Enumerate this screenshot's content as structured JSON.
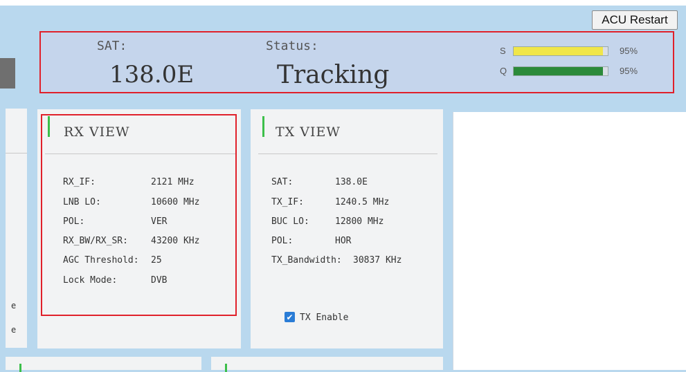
{
  "acu_restart_label": "ACU Restart",
  "header": {
    "sat_label": "SAT:",
    "sat_value": "138.0E",
    "status_label": "Status:",
    "status_value": "Tracking",
    "meters": [
      {
        "label": "S",
        "percent_text": "95%",
        "level": 0.95,
        "color": "#f0e64a"
      },
      {
        "label": "Q",
        "percent_text": "95%",
        "level": 0.95,
        "color": "#2b8a3a"
      }
    ]
  },
  "left_stub": {
    "items": [
      "e",
      "e"
    ]
  },
  "rx_view": {
    "title": "RX VIEW",
    "rows": [
      {
        "label": "RX_IF:",
        "value": "2121 MHz"
      },
      {
        "label": "LNB LO:",
        "value": "10600 MHz"
      },
      {
        "label": "POL:",
        "value": "VER"
      },
      {
        "label": "RX_BW/RX_SR:",
        "value": "43200 KHz"
      },
      {
        "label": "AGC Threshold:",
        "value": "25"
      },
      {
        "label": "Lock Mode:",
        "value": "DVB"
      }
    ]
  },
  "tx_view": {
    "title": "TX VIEW",
    "rows": [
      {
        "label": "SAT:",
        "value": "138.0E"
      },
      {
        "label": "TX_IF:",
        "value": "1240.5 MHz"
      },
      {
        "label": "BUC LO:",
        "value": "12800 MHz"
      },
      {
        "label": "POL:",
        "value": "HOR"
      },
      {
        "label": "TX_Bandwidth:",
        "value": "30837 KHz"
      }
    ],
    "tx_enable_label": "TX Enable",
    "tx_enable_checked": true
  },
  "colors": {
    "accent_green": "#3cbf4a",
    "highlight_red": "#e0202a",
    "checkbox_blue": "#2a7cd6"
  }
}
